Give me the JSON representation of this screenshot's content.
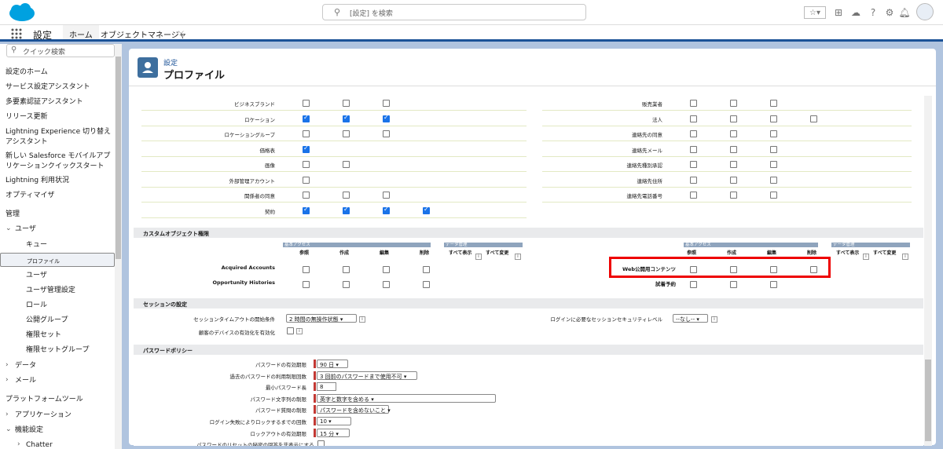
{
  "header": {
    "search_placeholder": "[設定] を検索"
  },
  "nav": {
    "title": "設定",
    "tab_home": "ホーム",
    "tab_object": "オブジェクトマネージャ"
  },
  "sidebar": {
    "search_placeholder": "クイック検索",
    "items": [
      "設定のホーム",
      "サービス設定アシスタント",
      "多要素認証アシスタント",
      "リリース更新",
      "Lightning Experience 切り替えアシスタント",
      "新しい Salesforce モバイルアプリケーションクイックスタート",
      "Lightning 利用状況",
      "オプティマイザ"
    ],
    "admin_heading": "管理",
    "users": "ユーザ",
    "user_sub": [
      "キュー",
      "プロファイル",
      "ユーザ",
      "ユーザ管理設定",
      "ロール",
      "公開グループ",
      "権限セット",
      "権限セットグループ"
    ],
    "data": "データ",
    "mail": "メール",
    "platform_heading": "プラットフォームツール",
    "apps": "アプリケーション",
    "features": "機能設定",
    "chatter": "Chatter"
  },
  "page": {
    "breadcrumb": "設定",
    "title": "プロファイル"
  },
  "std_left": [
    {
      "label": "ビジネスブランド",
      "checks": [
        false,
        false,
        false
      ]
    },
    {
      "label": "ロケーション",
      "checks": [
        true,
        true,
        true
      ]
    },
    {
      "label": "ロケーショングループ",
      "checks": [
        false,
        false,
        false
      ]
    },
    {
      "label": "価格表",
      "checks": [
        true
      ]
    },
    {
      "label": "画像",
      "checks": [
        false,
        false
      ]
    },
    {
      "label": "外部管理アカウント",
      "checks": [
        false
      ]
    },
    {
      "label": "関係者の同意",
      "checks": [
        false,
        false,
        false
      ]
    },
    {
      "label": "契約",
      "checks": [
        true,
        true,
        true,
        true
      ]
    }
  ],
  "std_right": [
    {
      "label": "販売業者",
      "checks": [
        false,
        false,
        false
      ]
    },
    {
      "label": "法人",
      "checks": [
        false,
        false,
        false,
        false
      ]
    },
    {
      "label": "連絡先の同意",
      "checks": [
        false,
        false,
        false
      ]
    },
    {
      "label": "連絡先メール",
      "checks": [
        false,
        false,
        false
      ]
    },
    {
      "label": "連絡先種別承認",
      "checks": [
        false,
        false,
        false
      ]
    },
    {
      "label": "連絡先住所",
      "checks": [
        false,
        false,
        false
      ]
    },
    {
      "label": "連絡先電話番号",
      "checks": [
        false,
        false,
        false
      ]
    }
  ],
  "custom": {
    "heading": "カスタムオブジェクト権限",
    "basic_access": "基本アクセス",
    "data_admin": "データ管理",
    "cols": [
      "参照",
      "作成",
      "編集",
      "削除"
    ],
    "view_all": "すべて表示",
    "modify_all": "すべて変更",
    "left_rows": [
      "Acquired Accounts",
      "Opportunity Histories"
    ],
    "right_rows": [
      "Web公開用コンテンツ",
      "試着予約"
    ]
  },
  "session": {
    "heading": "セッションの設定",
    "timeout_label": "セッションタイムアウトの開始条件",
    "timeout_value": "2 時間の無操作状態",
    "device_label": "顧客のデバイスの有効化を有効化",
    "security_label": "ログインに必要なセッションセキュリティレベル",
    "security_value": "--なし--"
  },
  "password": {
    "heading": "パスワードポリシー",
    "rows": [
      {
        "label": "パスワードの有効期限",
        "value": "90 日",
        "req": true
      },
      {
        "label": "過去のパスワードの利用制限回数",
        "value": "3 回前のパスワードまで使用不可",
        "req": true
      },
      {
        "label": "最小パスワード長",
        "value": "8",
        "req": true
      },
      {
        "label": "パスワード文字列の制限",
        "value": "英字と数字を含める",
        "req": true
      },
      {
        "label": "パスワード質問の制限",
        "value": "パスワードを含めないこと",
        "req": true
      },
      {
        "label": "ログイン失敗によりロックするまでの回数",
        "value": "10",
        "req": true
      },
      {
        "label": "ロックアウトの有効期限",
        "value": "15 分",
        "req": true
      },
      {
        "label": "パスワードのリセットの秘密の回答を非表示にする",
        "value": "",
        "req": false
      }
    ]
  }
}
